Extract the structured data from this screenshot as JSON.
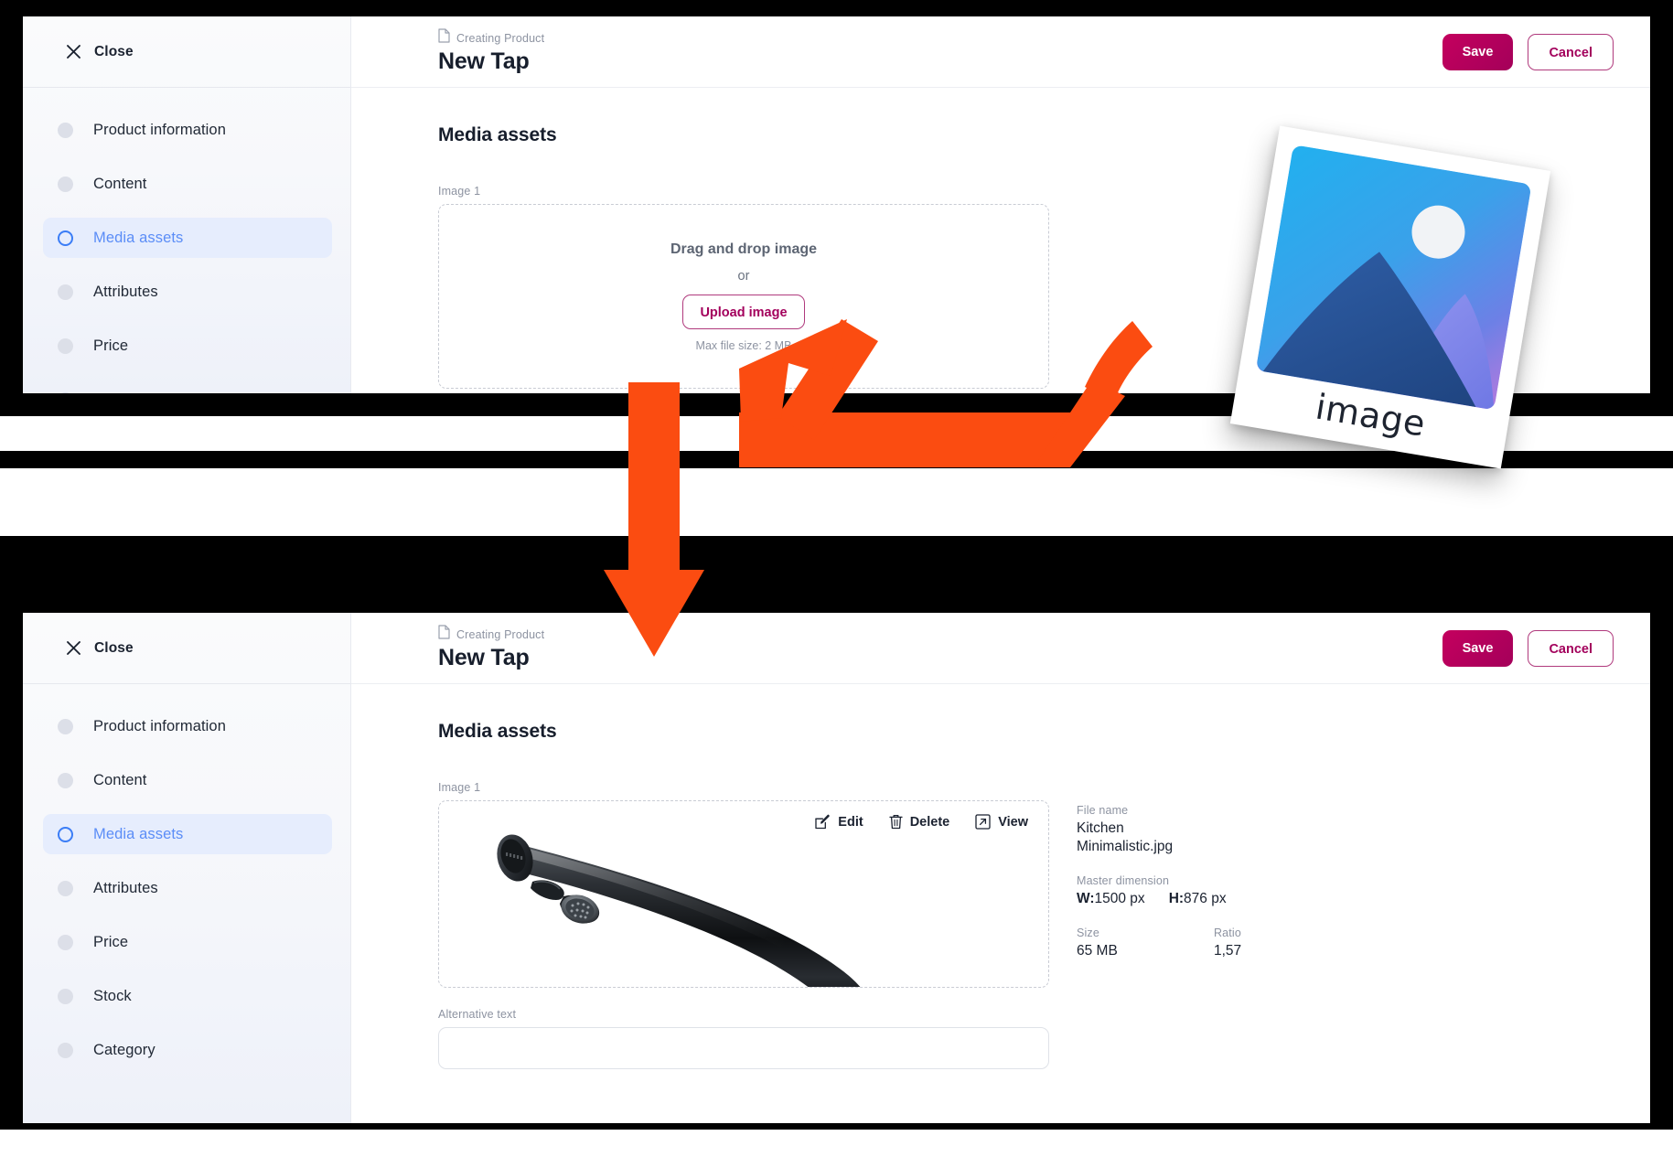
{
  "sidebar": {
    "close_label": "Close",
    "items": [
      {
        "label": "Product information",
        "active": false
      },
      {
        "label": "Content",
        "active": false
      },
      {
        "label": "Media assets",
        "active": true
      },
      {
        "label": "Attributes",
        "active": false
      },
      {
        "label": "Price",
        "active": false
      },
      {
        "label": "Stock",
        "active": false
      },
      {
        "label": "Category",
        "active": false
      }
    ]
  },
  "header": {
    "breadcrumb": "Creating Product",
    "title": "New Tap",
    "save_label": "Save",
    "cancel_label": "Cancel"
  },
  "main": {
    "section_title": "Media assets",
    "image_field_label": "Image 1"
  },
  "dropzone": {
    "title": "Drag and drop image",
    "or": "or",
    "upload_label": "Upload image",
    "max_size": "Max file size: 2 MB"
  },
  "preview": {
    "edit_label": "Edit",
    "delete_label": "Delete",
    "view_label": "View",
    "alt_text_label": "Alternative text",
    "alt_text_value": "",
    "alt_text_placeholder": ""
  },
  "file_meta": {
    "file_name_label": "File name",
    "file_name_line1": "Kitchen",
    "file_name_line2": "Minimalistic.jpg",
    "master_dimension_label": "Master dimension",
    "width_prefix": "W:",
    "width_value": "1500 px",
    "height_prefix": "H:",
    "height_value": "876 px",
    "size_label": "Size",
    "size_value": "65 MB",
    "ratio_label": "Ratio",
    "ratio_value": "1,57"
  },
  "polaroid": {
    "caption": "image"
  },
  "colors": {
    "accent_save": "#b5005c",
    "accent_outline": "#a3005c",
    "nav_active": "#5b8df7",
    "annotation_arrow": "#fb4c11",
    "frame": "#000000"
  }
}
